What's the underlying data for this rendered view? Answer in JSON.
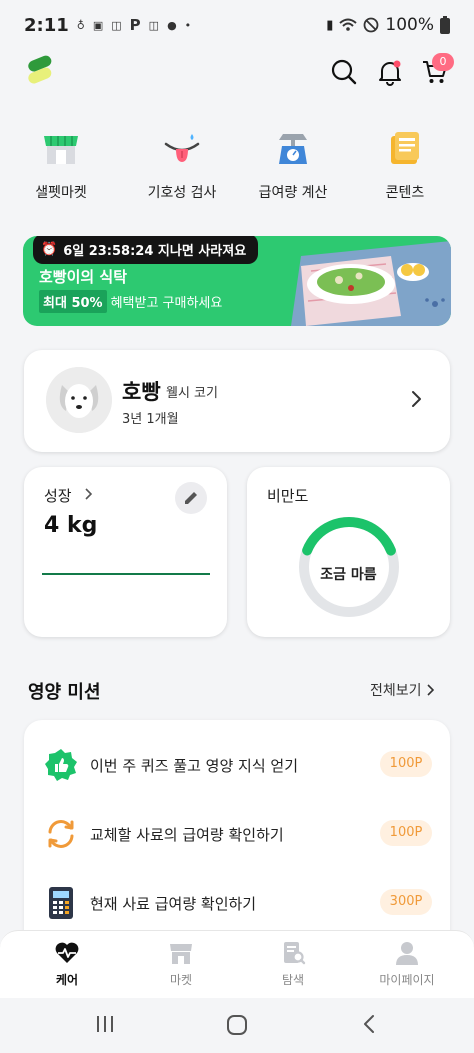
{
  "status_bar": {
    "time": "2:11",
    "battery": "100%",
    "notification_icons": [
      "steps-icon",
      "profile-icon",
      "temu-icon",
      "p-icon",
      "temu-icon",
      "c-icon",
      "dot-icon"
    ],
    "system_icons": [
      "battery-saver-icon",
      "wifi-icon",
      "dnd-icon",
      "battery-icon"
    ]
  },
  "header": {
    "cart_count": "0",
    "icons": [
      "logo-icon",
      "search-icon",
      "bell-icon",
      "cart-icon"
    ],
    "accent_color": "#2dc971",
    "badge_color": "#ff6b83"
  },
  "quick_menu": [
    {
      "label": "샐펫마켓",
      "icon": "store-icon"
    },
    {
      "label": "기호성 검사",
      "icon": "tongue-icon"
    },
    {
      "label": "급여량 계산",
      "icon": "scale-icon"
    },
    {
      "label": "콘텐츠",
      "icon": "content-icon"
    }
  ],
  "promo": {
    "countdown": "6일 23:58:24 지나면 사라져요",
    "title": "호빵이의 식탁",
    "highlight": "최대 50%",
    "subtitle": "혜택받고 구매하세요"
  },
  "profile": {
    "name": "호빵",
    "breed": "웰시 코기",
    "age": "3년 1개월"
  },
  "growth": {
    "title": "성장",
    "weight": "4 kg"
  },
  "obesity": {
    "title": "비만도",
    "status": "조금 마름",
    "level": 0.38
  },
  "missions": {
    "title": "영양 미션",
    "view_all": "전체보기",
    "items": [
      {
        "text": "이번 주 퀴즈 풀고 영양 지식 얻기",
        "points": "100P",
        "icon": "thumbs-up-icon"
      },
      {
        "text": "교체할 사료의 급여량 확인하기",
        "points": "100P",
        "icon": "refresh-icon"
      },
      {
        "text": "현재 사료 급여량 확인하기",
        "points": "300P",
        "icon": "calculator-icon"
      }
    ]
  },
  "bottom_nav": [
    {
      "label": "케어",
      "icon": "heart-pulse-icon",
      "active": true
    },
    {
      "label": "마켓",
      "icon": "store-icon",
      "active": false
    },
    {
      "label": "탐색",
      "icon": "search-doc-icon",
      "active": false
    },
    {
      "label": "마이페이지",
      "icon": "person-icon",
      "active": false
    }
  ]
}
